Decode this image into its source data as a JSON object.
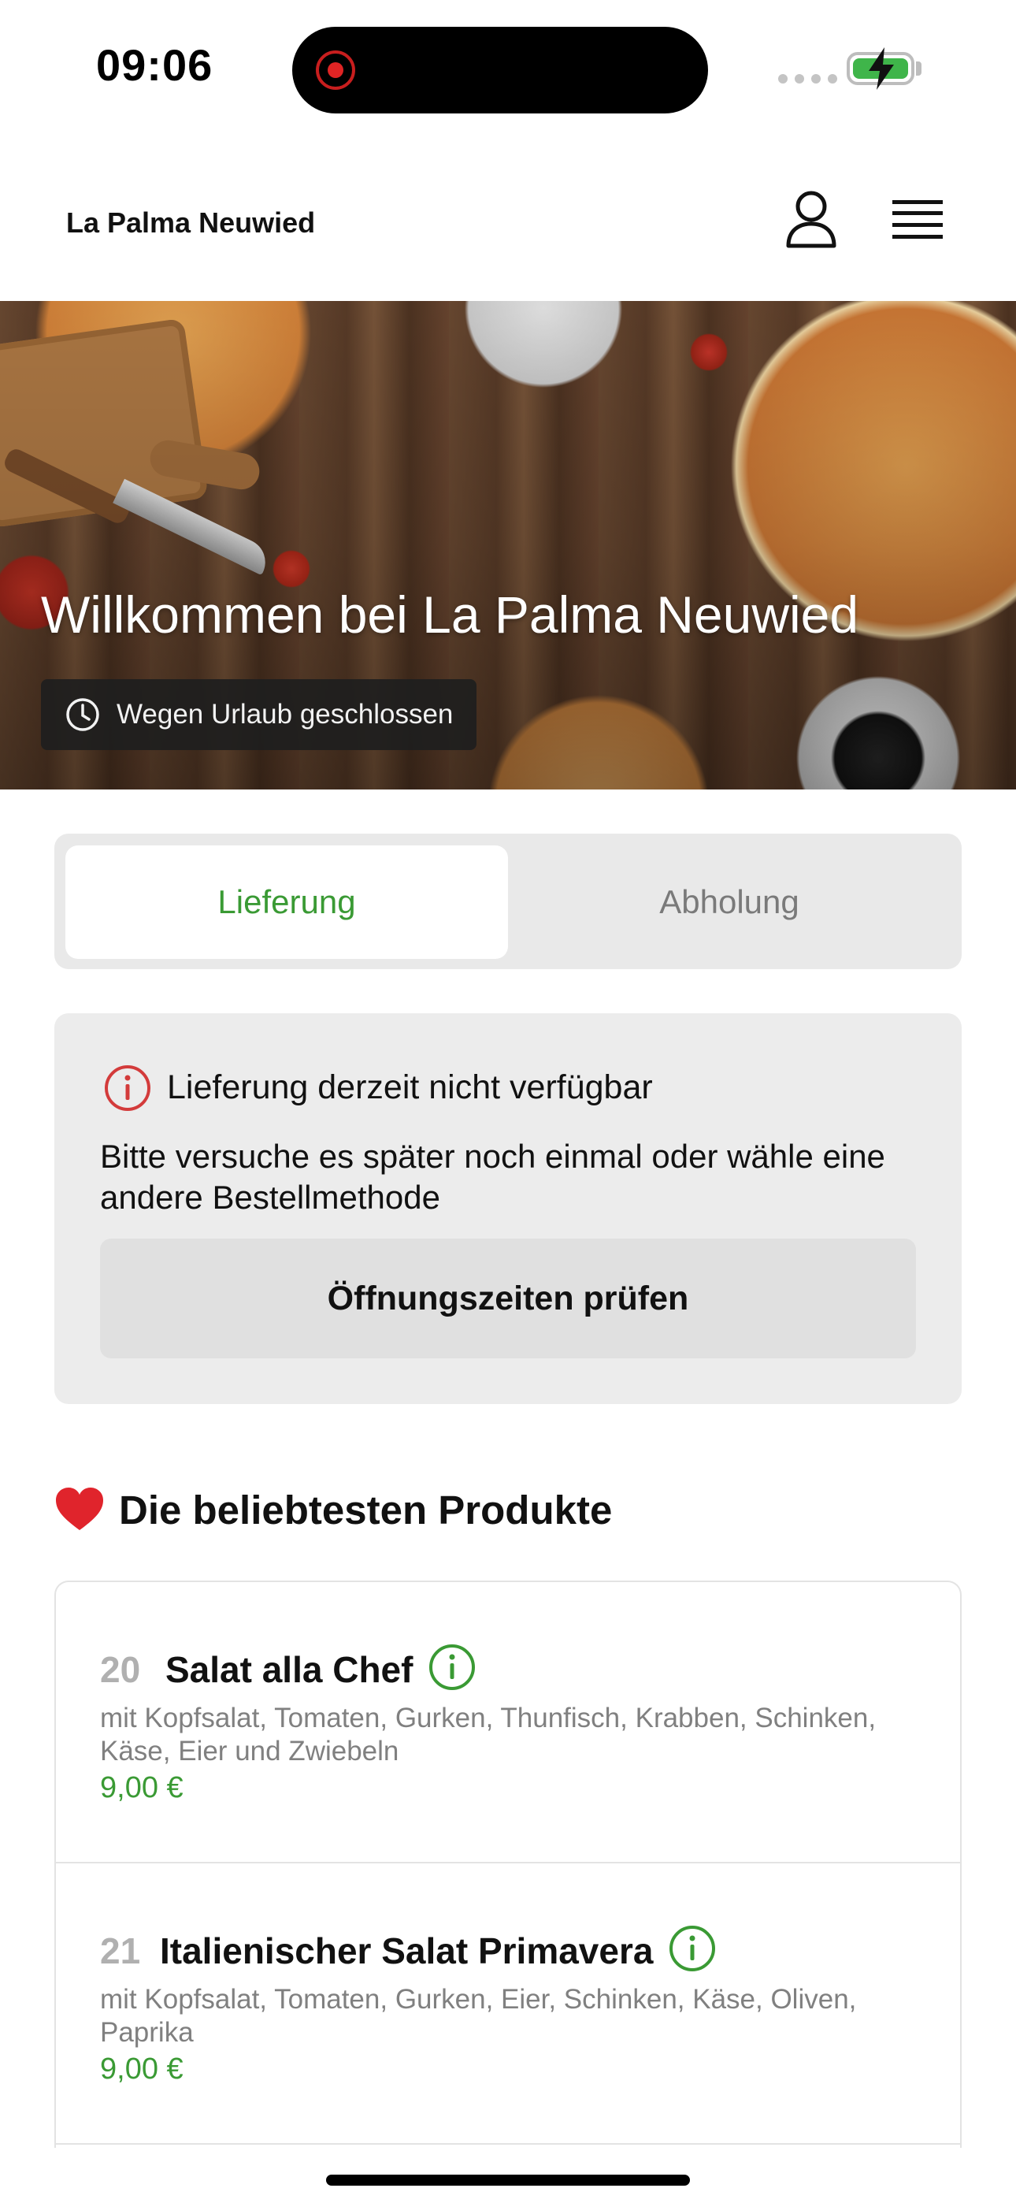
{
  "status_bar": {
    "time": "09:06"
  },
  "header": {
    "brand": "La Palma Neuwied"
  },
  "hero": {
    "title": "Willkommen bei La Palma Neuwied",
    "status": "Wegen Urlaub geschlossen"
  },
  "order_mode": {
    "options": [
      "Lieferung",
      "Abholung"
    ],
    "selected": "Lieferung"
  },
  "notice": {
    "title": "Lieferung derzeit nicht verfügbar",
    "text": "Bitte versuche es später noch einmal oder wähle eine andere Bestellmethode",
    "button": "Öffnungszeiten prüfen"
  },
  "popular": {
    "heading": "Die beliebtesten Produkte",
    "products": [
      {
        "number": "20",
        "name": "Salat alla Chef",
        "description": "mit Kopfsalat, Tomaten, Gurken, Thunfisch, Krabben, Schinken, Käse, Eier und Zwiebeln",
        "price": "9,00 €"
      },
      {
        "number": "21",
        "name": "Italienischer Salat Primavera",
        "description": "mit Kopfsalat, Tomaten, Gurken, Eier, Schinken, Käse, Oliven, Paprika",
        "price": "9,00 €"
      }
    ]
  },
  "colors": {
    "accent_green": "#3a9a34",
    "notice_red": "#d33b3b",
    "heart_red": "#e0242c"
  },
  "icons": {
    "status": [
      "record-icon",
      "signal-icon",
      "battery-charging-icon"
    ],
    "header": [
      "user-icon",
      "menu-icon"
    ],
    "hero": "clock-icon",
    "notice": "info-icon",
    "heading": "heart-icon",
    "product": "info-icon"
  }
}
